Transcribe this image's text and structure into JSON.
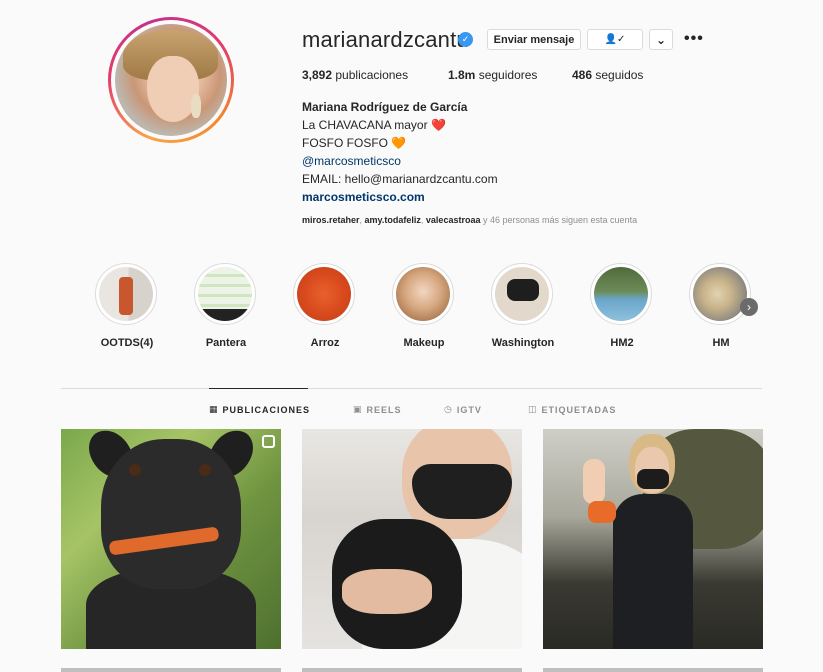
{
  "profile": {
    "username": "marianardzcantu",
    "verified_mark": "✓",
    "send_message_label": "Enviar mensaje",
    "following_icon": "👤✓",
    "dropdown_icon": "⌄",
    "more_icon": "•••",
    "stats": {
      "posts_count": "3,892",
      "posts_label": "publicaciones",
      "followers_count": "1.8m",
      "followers_label": "seguidores",
      "following_count": "486",
      "following_label": "seguidos"
    },
    "bio": {
      "full_name": "Mariana Rodríguez de García",
      "line1": "La CHAVACANA mayor",
      "line1_emoji": "❤️",
      "line2": "FOSFO FOSFO",
      "line2_emoji": "🧡",
      "mention": "@marcosmeticsco",
      "email": "EMAIL: hello@marianardzcantu.com",
      "website": "marcosmeticsco.com"
    },
    "followed_by": {
      "user1": "miros.retaher",
      "user2": "amy.todafeliz",
      "user3": "valecastroaa",
      "suffix": "y 46 personas más siguen esta cuenta"
    }
  },
  "highlights": [
    {
      "label": "OOTDS(4)"
    },
    {
      "label": "Pantera"
    },
    {
      "label": "Arroz"
    },
    {
      "label": "Makeup"
    },
    {
      "label": "Washington"
    },
    {
      "label": "HM2"
    },
    {
      "label": "HM"
    }
  ],
  "highlights_next_icon": "›",
  "tabs": [
    {
      "label": "PUBLICACIONES",
      "icon": "▦"
    },
    {
      "label": "REELS",
      "icon": "▣"
    },
    {
      "label": "IGTV",
      "icon": "◷"
    },
    {
      "label": "ETIQUETADAS",
      "icon": "◫"
    }
  ],
  "colors": {
    "verified_blue": "#3897f0",
    "link_blue": "#00376b",
    "ring_gradient_start": "#f9a54b",
    "ring_gradient_end": "#c2318e"
  }
}
